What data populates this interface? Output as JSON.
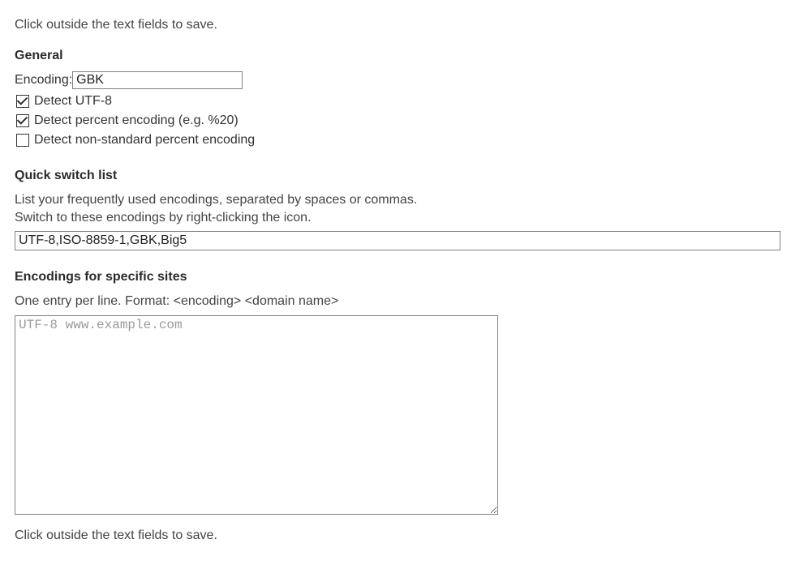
{
  "hint_top": "Click outside the text fields to save.",
  "hint_bottom": "Click outside the text fields to save.",
  "general": {
    "heading": "General",
    "encoding_label": "Encoding:",
    "encoding_value": "GBK",
    "detect_utf8": {
      "label": "Detect UTF-8",
      "checked": true
    },
    "detect_percent": {
      "label": "Detect percent encoding (e.g. %20)",
      "checked": true
    },
    "detect_nonstd_percent": {
      "label": "Detect non-standard percent encoding",
      "checked": false
    }
  },
  "quick_switch": {
    "heading": "Quick switch list",
    "help_line1": "List your frequently used encodings, separated by spaces or commas.",
    "help_line2": "Switch to these encodings by right-clicking the icon.",
    "value": "UTF-8,ISO-8859-1,GBK,Big5"
  },
  "site_encodings": {
    "heading": "Encodings for specific sites",
    "help": "One entry per line. Format: <encoding> <domain name>",
    "placeholder": "UTF-8 www.example.com",
    "value": ""
  }
}
